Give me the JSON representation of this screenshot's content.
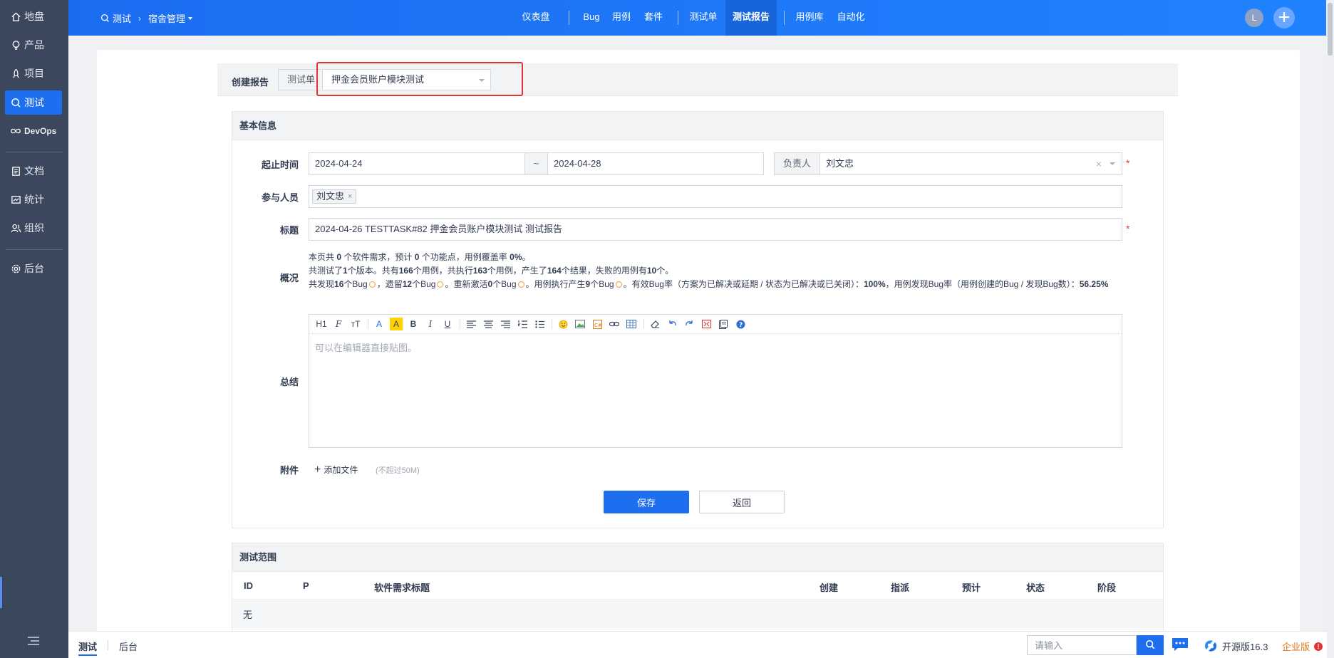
{
  "sidebar": {
    "items": [
      {
        "label": "地盘",
        "icon": "home-icon"
      },
      {
        "label": "产品",
        "icon": "lightbulb-icon"
      },
      {
        "label": "项目",
        "icon": "rocket-icon"
      },
      {
        "label": "测试",
        "icon": "test-search-icon"
      },
      {
        "label": "DevOps",
        "icon": "infinity-icon"
      },
      {
        "label": "文档",
        "icon": "document-icon"
      },
      {
        "label": "统计",
        "icon": "chart-icon"
      },
      {
        "label": "组织",
        "icon": "people-icon"
      },
      {
        "label": "后台",
        "icon": "gear-icon"
      }
    ]
  },
  "header": {
    "breadcrumb": {
      "module": "测试",
      "product": "宿舍管理"
    },
    "nav": [
      "仪表盘",
      "Bug",
      "用例",
      "套件",
      "测试单",
      "测试报告",
      "用例库",
      "自动化"
    ],
    "active_nav": "测试报告",
    "avatar_initial": "L"
  },
  "report_bar": {
    "label": "创建报告",
    "addon": "测试单",
    "selected_testtask": "押金会员账户模块测试"
  },
  "basic_info": {
    "title": "基本信息",
    "date_label": "起止时间",
    "start_date": "2024-04-24",
    "range_sep": "~",
    "end_date": "2024-04-28",
    "owner_label": "负责人",
    "owner": "刘文忠",
    "members_label": "参与人员",
    "member_chip": "刘文忠",
    "title_label": "标题",
    "report_title": "2024-04-26 TESTTASK#82 押金会员账户模块测试 测试报告",
    "overview_label": "概况",
    "overview": {
      "l1_a": "本页共",
      "l1_stories": "0",
      "l1_b": "个软件需求，预计",
      "l1_points": "0",
      "l1_c": "个功能点，用例覆盖率",
      "l1_coverage": "0%",
      "l1_d": "。",
      "l2_a": "共测试了",
      "l2_builds": "1",
      "l2_b": "个版本。共有",
      "l2_cases": "166",
      "l2_c": "个用例，共执行",
      "l2_run": "163",
      "l2_d": "个用例，产生了",
      "l2_results": "164",
      "l2_e": "个结果，失败的用例有",
      "l2_failed": "10",
      "l2_f": "个。",
      "l3_a": "共发现",
      "l3_found": "16",
      "l3_b": "个Bug",
      "l3_c": "，遗留",
      "l3_left": "12",
      "l3_d": "个Bug",
      "l3_e": "。重新激活",
      "l3_reactivated": "0",
      "l3_f": "个Bug",
      "l3_g": "。用例执行产生",
      "l3_from_cases": "9",
      "l3_h": "个Bug",
      "l3_i": "。有效Bug率（方案为已解决或延期 / 状态为已解决或已关闭）：",
      "l3_valid_rate": "100%",
      "l3_j": "，用例发现Bug率（用例创建的Bug / 发现Bug数）：",
      "l3_case_rate": "56.25%"
    },
    "summary_label": "总结",
    "editor_placeholder": "可以在编辑器直接贴图。",
    "toolbar": {
      "h1": "H1",
      "font": "F",
      "size": "тT",
      "color": "A",
      "bg": "A",
      "bold": "B",
      "italic": "I",
      "underline": "U"
    },
    "files_label": "附件",
    "add_file": "添加文件",
    "file_limit": "(不超过50M)",
    "save": "保存",
    "back": "返回"
  },
  "scope": {
    "title": "测试范围",
    "columns": [
      "ID",
      "P",
      "软件需求标题",
      "创建",
      "指派",
      "预计",
      "状态",
      "阶段"
    ],
    "empty": "无"
  },
  "footer": {
    "crumb1": "测试",
    "crumb2": "后台",
    "search_placeholder": "请输入",
    "edition": "开源版16.3",
    "enterprise": "企业版",
    "enterprise_badge": "!"
  },
  "colors": {
    "primary": "#1d6ff0",
    "sidebar": "#3b475d",
    "required": "#e53333",
    "highlight": "#e53333"
  }
}
